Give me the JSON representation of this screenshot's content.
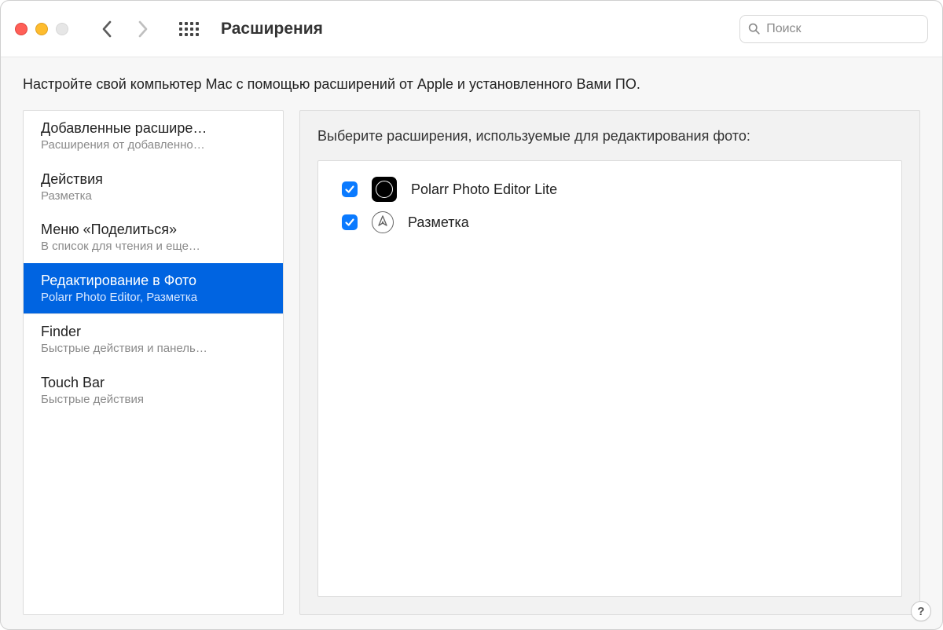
{
  "window": {
    "title": "Расширения"
  },
  "search": {
    "placeholder": "Поиск",
    "value": ""
  },
  "description": "Настройте свой компьютер Mac с помощью расширений от Apple и установленного Вами ПО.",
  "sidebar": {
    "items": [
      {
        "title": "Добавленные расшире…",
        "subtitle": "Расширения от добавленно…"
      },
      {
        "title": "Действия",
        "subtitle": "Разметка"
      },
      {
        "title": "Меню «Поделиться»",
        "subtitle": "В список для чтения и еще…"
      },
      {
        "title": "Редактирование в Фото",
        "subtitle": "Polarr Photo Editor, Разметка"
      },
      {
        "title": "Finder",
        "subtitle": "Быстрые действия и панель…"
      },
      {
        "title": "Touch Bar",
        "subtitle": "Быстрые действия"
      }
    ],
    "selected_index": 3
  },
  "panel": {
    "heading": "Выберите расширения, используемые для редактирования фото:",
    "extensions": [
      {
        "checked": true,
        "icon": "polarr",
        "label": "Polarr Photo Editor Lite"
      },
      {
        "checked": true,
        "icon": "markup",
        "label": "Разметка"
      }
    ]
  },
  "help": {
    "label": "?"
  }
}
